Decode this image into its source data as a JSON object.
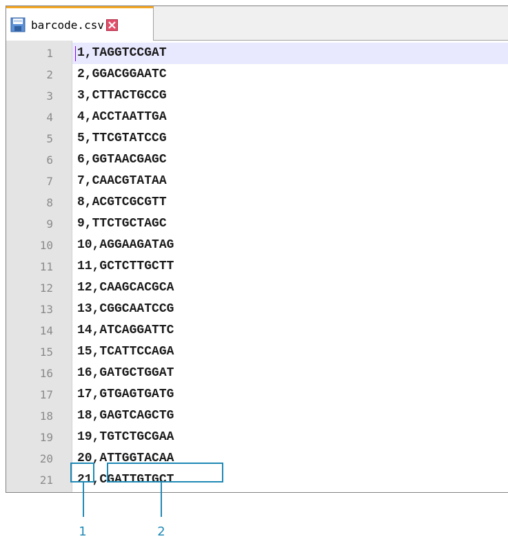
{
  "tab": {
    "filename": "barcode.csv"
  },
  "icons": {
    "tab_icon": "save-icon",
    "tab_close": "close-icon"
  },
  "colors": {
    "tab_accent": "#f5a623",
    "callout": "#1e88b4",
    "current_line": "#e8e8ff",
    "gutter": "#e4e4e4"
  },
  "lines": [
    {
      "num": "1",
      "text": "1,TAGGTCCGAT"
    },
    {
      "num": "2",
      "text": "2,GGACGGAATC"
    },
    {
      "num": "3",
      "text": "3,CTTACTGCCG"
    },
    {
      "num": "4",
      "text": "4,ACCTAATTGA"
    },
    {
      "num": "5",
      "text": "5,TTCGTATCCG"
    },
    {
      "num": "6",
      "text": "6,GGTAACGAGC"
    },
    {
      "num": "7",
      "text": "7,CAACGTATAA"
    },
    {
      "num": "8",
      "text": "8,ACGTCGCGTT"
    },
    {
      "num": "9",
      "text": "9,TTCTGCTAGC"
    },
    {
      "num": "10",
      "text": "10,AGGAAGATAG"
    },
    {
      "num": "11",
      "text": "11,GCTCTTGCTT"
    },
    {
      "num": "12",
      "text": "12,CAAGCACGCA"
    },
    {
      "num": "13",
      "text": "13,CGGCAATCCG"
    },
    {
      "num": "14",
      "text": "14,ATCAGGATTC"
    },
    {
      "num": "15",
      "text": "15,TCATTCCAGA"
    },
    {
      "num": "16",
      "text": "16,GATGCTGGAT"
    },
    {
      "num": "17",
      "text": "17,GTGAGTGATG"
    },
    {
      "num": "18",
      "text": "18,GAGTCAGCTG"
    },
    {
      "num": "19",
      "text": "19,TGTCTGCGAA"
    },
    {
      "num": "20",
      "text": "20,ATTGGTACAA"
    },
    {
      "num": "21",
      "text": "21,CGATTGTGCT"
    }
  ],
  "callouts": {
    "label_1": "1",
    "label_2": "2"
  }
}
